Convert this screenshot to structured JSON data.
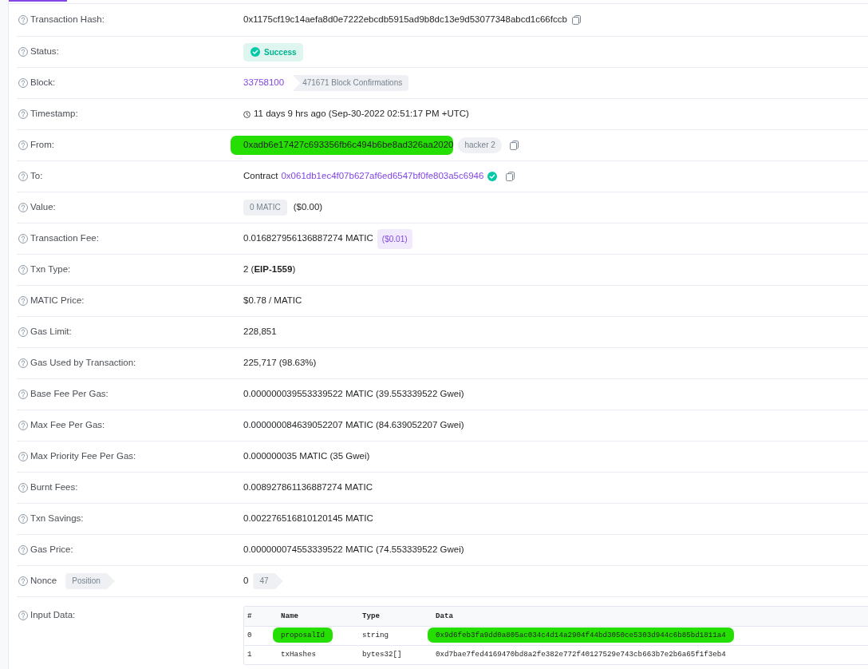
{
  "details": [
    {
      "kind": "copy",
      "label": "Transaction Hash:",
      "value": "0x1175cf19c14aefa8d0e7222ebcdb5915ad9b8dc13e9d53077348abcd1c66fccb"
    },
    {
      "kind": "status",
      "label": "Status:",
      "value": "Success"
    },
    {
      "kind": "block",
      "label": "Block:",
      "link": "33758100",
      "badge": "471671 Block Confirmations"
    },
    {
      "kind": "timestamp",
      "label": "Timestamp:",
      "value": "11 days 9 hrs ago (Sep-30-2022 02:51:17 PM +UTC)"
    },
    {
      "kind": "address",
      "label": "From:",
      "value": "0xadb6e17427c693356fb6c494b6be8ad326aa2020",
      "highlighted": true,
      "tag": "hacker 2"
    },
    {
      "kind": "contract",
      "label": "To:",
      "prefix": "Contract",
      "link": "0x061db1ec4f07b627af6ed6547bf0fe803a5c6946",
      "verified": true
    },
    {
      "kind": "amount",
      "label": "Value:",
      "badge": "0 MATIC",
      "value": "($0.00)"
    },
    {
      "kind": "fee",
      "label": "Transaction Fee:",
      "value": "0.016827956136887274 MATIC",
      "badge": "($0.01)"
    },
    {
      "kind": "text",
      "label": "Txn Type:",
      "value": "2 (**EIP-1559**)"
    },
    {
      "kind": "text",
      "label": "MATIC Price:",
      "value": "$0.78 / MATIC"
    },
    {
      "kind": "text",
      "label": "Gas Limit:",
      "value": "228,851"
    },
    {
      "kind": "text",
      "label": "Gas Used by Transaction:",
      "value": "225,717 (98.63%)"
    },
    {
      "kind": "text",
      "label": "Base Fee Per Gas:",
      "value": "0.000000039553339522 MATIC (39.553339522 Gwei)"
    },
    {
      "kind": "text",
      "label": "Max Fee Per Gas:",
      "value": "0.000000084639052207 MATIC (84.639052207 Gwei)"
    },
    {
      "kind": "text",
      "label": "Max Priority Fee Per Gas:",
      "value": "0.000000035 MATIC (35 Gwei)"
    },
    {
      "kind": "text",
      "label": "Burnt Fees:",
      "value": "0.008927861136887274 MATIC"
    },
    {
      "kind": "text",
      "label": "Txn Savings:",
      "value": "0.002276516810120145 MATIC"
    },
    {
      "kind": "text",
      "label": "Gas Price:",
      "value": "0.000000074553339522 MATIC (74.553339522 Gwei)"
    },
    {
      "kind": "nonce",
      "label": "Nonce",
      "label_badge": "Position",
      "value": "0",
      "badge": "47"
    },
    {
      "kind": "input",
      "label": "Input Data:",
      "table": {
        "columns": [
          "#",
          "Name",
          "Type",
          "Data"
        ],
        "rows": [
          {
            "cells": [
              {
                "text": "0",
                "highlighted": false
              },
              {
                "text": "proposalId",
                "highlighted": true
              },
              {
                "text": "string",
                "highlighted": false
              },
              {
                "text": "0x9d6feb3fa9dd0a805ac034c4d14a2904f44bd3050ce5303d944c6b85bd1811a4",
                "highlighted": true
              }
            ]
          },
          {
            "cells": [
              {
                "text": "1",
                "highlighted": false
              },
              {
                "text": "txHashes",
                "highlighted": false
              },
              {
                "text": "bytes32[]",
                "highlighted": false
              },
              {
                "text": "0xd7bae7fed4169470bd8a2fe382e772f40127529e743cb663b7e2b6a65f1f3eb4",
                "highlighted": false
              }
            ]
          }
        ]
      }
    }
  ]
}
